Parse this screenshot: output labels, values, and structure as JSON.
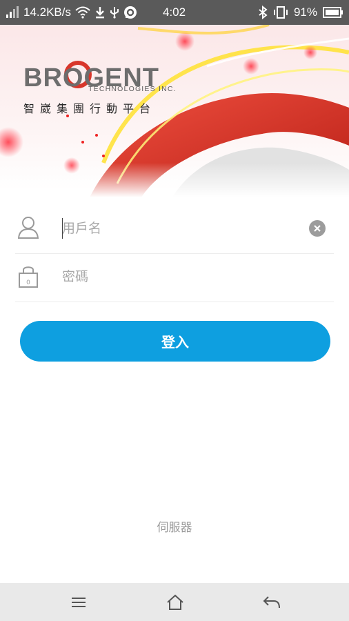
{
  "status_bar": {
    "net_speed": "14.2KB/s",
    "time": "4:02",
    "battery_pct": "91%",
    "icons": [
      "signal-icon",
      "wifi-icon",
      "download-icon",
      "usb-icon",
      "chat-icon",
      "bluetooth-icon",
      "vibrate-icon",
      "battery-icon"
    ]
  },
  "banner": {
    "logo_text": "BROGENT",
    "logo_subtitle": "TECHNOLOGIES INC.",
    "tagline": "智崴集團行動平台"
  },
  "login_form": {
    "username": {
      "value": "",
      "placeholder": "用戶名",
      "icon": "user-icon"
    },
    "password": {
      "value": "",
      "placeholder": "密碼",
      "icon": "lock-icon"
    },
    "submit_label": "登入"
  },
  "server_label": "伺服器",
  "nav_bar": {
    "icons": [
      "menu-icon",
      "home-icon",
      "back-icon"
    ]
  },
  "colors": {
    "accent": "#0e9fe0",
    "status_bar": "#5a5a5a",
    "nav_bar": "#e9e9e9",
    "brand_red": "#d8362b"
  }
}
